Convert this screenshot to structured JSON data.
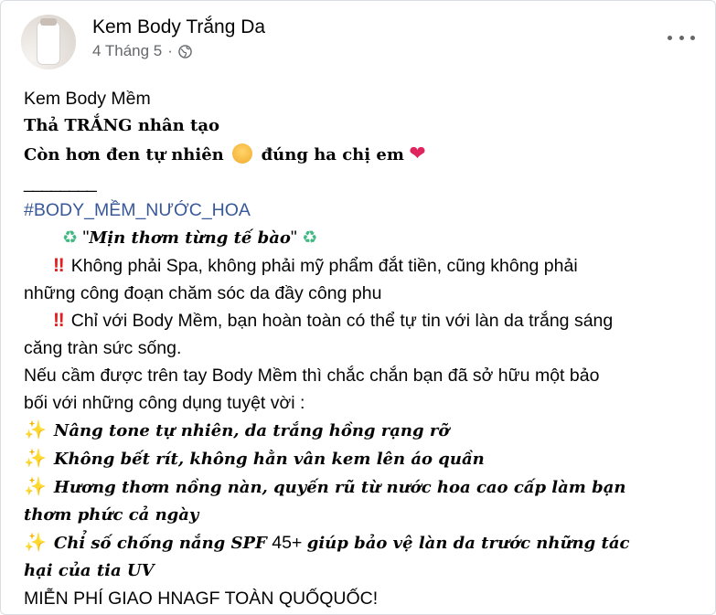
{
  "post": {
    "page_name": "Kem Body Trắng Da",
    "date": "4 Tháng 5",
    "dot": "·"
  },
  "content": {
    "l1": "Kem Body Mềm",
    "l2": "Thả TRẮNG nhân tạo",
    "l3a": "Còn hơn đen tự nhiên",
    "l3b": "đúng ha chị em",
    "separator": "________",
    "hashtag": "#BODY_MỀM_NƯỚC_HOA",
    "tagline_prefix": "\"",
    "tagline": "Mịn thơm từng tế bào",
    "tagline_suffix": "\"",
    "p1a": "Không phải Spa, không phải mỹ phẩm đắt tiền, cũng không phải",
    "p1b": "những công đoạn chăm sóc da đầy công phu",
    "p2a": "Chỉ với Body Mềm, bạn hoàn toàn có thể tự tin với làn da trắng sáng",
    "p2b": "căng tràn sức sống.",
    "p3a": "Nếu cầm được trên tay Body Mềm thì chắc chắn bạn đã sở hữu một bảo",
    "p3b": "bối với những công dụng tuyệt vời :",
    "b1": "Nâng tone tự nhiên, da trắng hồng rạng rỡ",
    "b2": "Không bết rít, không hằn vân kem lên áo quần",
    "b3a": "Hương thơm nồng nàn, quyến rũ từ nước hoa cao cấp làm bạn",
    "b3b": "thơm phức cả ngày",
    "b4a_1": "Chỉ số chống nắng SPF",
    "b4a_num": " 45+ ",
    "b4a_2": "giúp bảo vệ làn da trước những tác",
    "b4b": "hại của tia UV",
    "footer": "MIỄN PHÍ GIAO HNAGF TOÀN QUỐQUỐC!"
  },
  "icons": {
    "more": "more-options-icon",
    "globe": "globe-icon",
    "bang": "‼",
    "spark": "✨",
    "recycle": "♻",
    "heart": "❤"
  }
}
